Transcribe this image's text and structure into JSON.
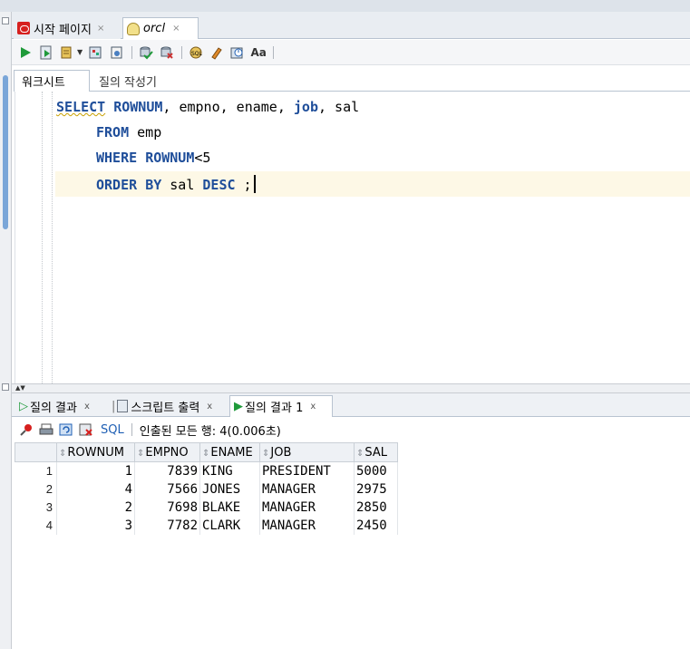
{
  "doc_tabs": [
    {
      "label": "시작 페이지",
      "icon": "oracle-icon",
      "close": "×"
    },
    {
      "label": "orcl",
      "icon": "database-icon",
      "close": "×"
    }
  ],
  "toolbar": {
    "icons": [
      "run-statement-icon",
      "run-script-icon",
      "explain-plan-icon",
      "autotrace-icon",
      "commit-icon",
      "rollback-icon",
      "sql-tuning-icon",
      "clear-icon",
      "sql-history-icon",
      "format-case-icon"
    ],
    "format_label": "Aa"
  },
  "sub_tabs": [
    "워크시트",
    "질의 작성기"
  ],
  "editor": {
    "line1": {
      "k1": "SELECT",
      "k2": "ROWNUM",
      "t1": ", empno, ename, ",
      "k3": "job",
      "t2": ", sal"
    },
    "line2": {
      "k1": "FROM",
      "t1": " emp"
    },
    "line3": {
      "k1": "WHERE",
      "k2": "ROWNUM",
      "t1": "<5"
    },
    "line4": {
      "k1": "ORDER",
      "k2": "BY",
      "t1": " sal ",
      "k3": "DESC",
      "t2": " ;"
    }
  },
  "splitter": "▲▼",
  "result_tabs": [
    {
      "label": "질의 결과",
      "close": "x"
    },
    {
      "label": "스크립트 출력",
      "close": "x"
    },
    {
      "label": "질의 결과 1",
      "close": "x"
    }
  ],
  "result_toolbar": {
    "sql_label": "SQL",
    "status": "인출된 모든 행: 4(0.006초)"
  },
  "grid": {
    "columns": [
      "ROWNUM",
      "EMPNO",
      "ENAME",
      "JOB",
      "SAL"
    ],
    "rows": [
      {
        "n": "1",
        "ROWNUM": "1",
        "EMPNO": "7839",
        "ENAME": "KING",
        "JOB": "PRESIDENT",
        "SAL": "5000"
      },
      {
        "n": "2",
        "ROWNUM": "4",
        "EMPNO": "7566",
        "ENAME": "JONES",
        "JOB": "MANAGER",
        "SAL": "2975"
      },
      {
        "n": "3",
        "ROWNUM": "2",
        "EMPNO": "7698",
        "ENAME": "BLAKE",
        "JOB": "MANAGER",
        "SAL": "2850"
      },
      {
        "n": "4",
        "ROWNUM": "3",
        "EMPNO": "7782",
        "ENAME": "CLARK",
        "JOB": "MANAGER",
        "SAL": "2450"
      }
    ]
  },
  "colors": {
    "keyword": "#1f4e9a",
    "current_line": "#fdf8e6",
    "run_green": "#1f9a3a",
    "oracle_red": "#d6201e",
    "link_blue": "#1f5fb4"
  }
}
